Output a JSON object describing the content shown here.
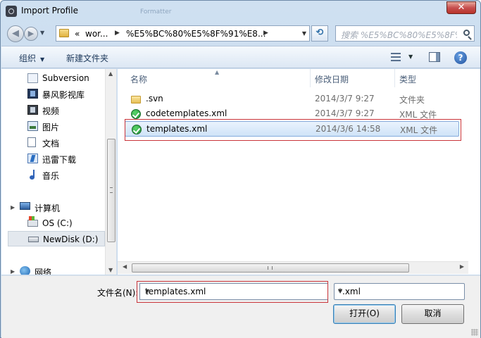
{
  "window": {
    "title": "Import Profile",
    "background_title": "Formatter",
    "close_label": "✕"
  },
  "address_bar": {
    "breadcrumbs": [
      "«",
      "wor...",
      "%E5%BC%80%E5%8F%91%E8..."
    ],
    "search_placeholder": "搜索 %E5%BC%80%E5%8F%91%E8..."
  },
  "toolbar": {
    "organize_label": "组织",
    "new_folder_label": "新建文件夹"
  },
  "nav_pane": {
    "items": [
      {
        "label": "Subversion",
        "icon": "subversion-icon"
      },
      {
        "label": "暴风影视库",
        "icon": "video-library-icon"
      },
      {
        "label": "视频",
        "icon": "video-icon"
      },
      {
        "label": "图片",
        "icon": "pictures-icon"
      },
      {
        "label": "文档",
        "icon": "documents-icon"
      },
      {
        "label": "迅雷下载",
        "icon": "thunder-download-icon"
      },
      {
        "label": "音乐",
        "icon": "music-icon"
      },
      {
        "label": "计算机",
        "icon": "computer-icon"
      },
      {
        "label": "OS (C:)",
        "icon": "os-drive-icon"
      },
      {
        "label": "NewDisk (D:)",
        "icon": "disk-drive-icon"
      },
      {
        "label": "网络",
        "icon": "network-icon"
      }
    ]
  },
  "file_list": {
    "columns": {
      "name": "名称",
      "date": "修改日期",
      "type": "类型"
    },
    "rows": [
      {
        "name": ".svn",
        "date": "2014/3/7 9:27",
        "type": "文件夹",
        "icon": "folder-icon"
      },
      {
        "name": "codetemplates.xml",
        "date": "2014/3/7 9:27",
        "type": "XML 文件",
        "icon": "xml-file-icon"
      },
      {
        "name": "templates.xml",
        "date": "2014/3/6 14:58",
        "type": "XML 文件",
        "icon": "xml-file-icon",
        "selected": true
      }
    ]
  },
  "bottom": {
    "filename_label": "文件名(N):",
    "filename_value": "templates.xml",
    "filetype_value": "*.xml",
    "open_label": "打开(O)",
    "cancel_label": "取消"
  },
  "colors": {
    "highlight_box": "#c9343a",
    "selection": "#cfe3f8"
  }
}
